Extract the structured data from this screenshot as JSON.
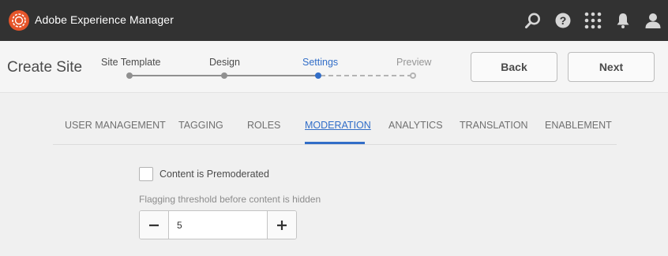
{
  "app": {
    "title": "Adobe Experience Manager",
    "brand_color": "#e5542a",
    "topbar_bg": "#323232"
  },
  "topbar_icons": [
    "search-icon",
    "help-icon",
    "apps-icon",
    "notifications-icon",
    "user-icon"
  ],
  "wizard": {
    "title": "Create Site",
    "steps": [
      {
        "label": "Site Template",
        "state": "done"
      },
      {
        "label": "Design",
        "state": "done"
      },
      {
        "label": "Settings",
        "state": "current"
      },
      {
        "label": "Preview",
        "state": "upcoming"
      }
    ],
    "back_label": "Back",
    "next_label": "Next",
    "accent_color": "#326ec8"
  },
  "tabs": [
    {
      "label": "USER MANAGEMENT",
      "active": false
    },
    {
      "label": "TAGGING",
      "active": false
    },
    {
      "label": "ROLES",
      "active": false
    },
    {
      "label": "MODERATION",
      "active": true
    },
    {
      "label": "ANALYTICS",
      "active": false
    },
    {
      "label": "TRANSLATION",
      "active": false
    },
    {
      "label": "ENABLEMENT",
      "active": false
    }
  ],
  "moderation": {
    "premoderated_label": "Content is Premoderated",
    "premoderated_checked": false,
    "threshold_label": "Flagging threshold before content is hidden",
    "threshold_value": "5"
  }
}
